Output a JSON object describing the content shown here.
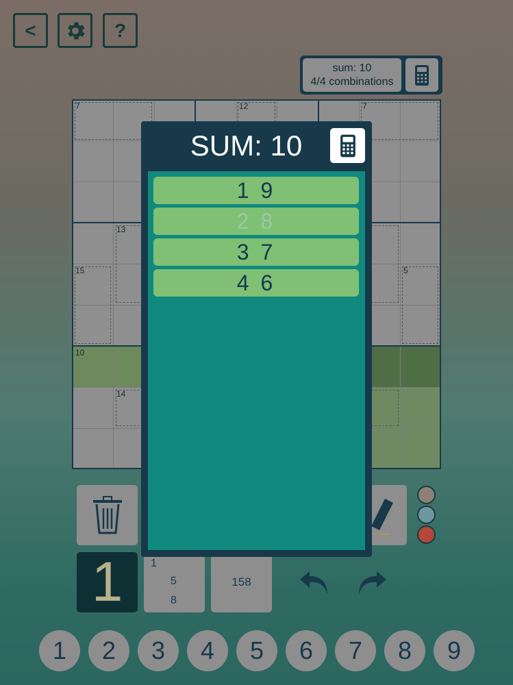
{
  "toolbar": {
    "back_label": "<",
    "help_label": "?"
  },
  "sum_info": {
    "line1": "sum: 10",
    "line2": "4/4 combinations"
  },
  "board": {
    "cage_labels": [
      "7",
      "12",
      "7",
      "13",
      "15",
      "5",
      "10",
      "14"
    ]
  },
  "popup": {
    "title": "SUM: 10",
    "combinations": [
      {
        "text": "1 9",
        "disabled": false
      },
      {
        "text": "2 8",
        "disabled": true
      },
      {
        "text": "3 7",
        "disabled": false
      },
      {
        "text": "4 6",
        "disabled": false
      }
    ]
  },
  "controls": {
    "selected_digit": "1",
    "pencil_small": [
      "1",
      "5",
      "8"
    ],
    "pencil_center": "158",
    "colors": [
      "#8d8177",
      "#6f97a1",
      "#b3473b"
    ]
  },
  "numpad": [
    "1",
    "2",
    "3",
    "4",
    "5",
    "6",
    "7",
    "8",
    "9"
  ],
  "colors": {
    "primary_dark": "#17394a",
    "combo_green": "#7fc074",
    "list_teal": "#108a7e"
  }
}
